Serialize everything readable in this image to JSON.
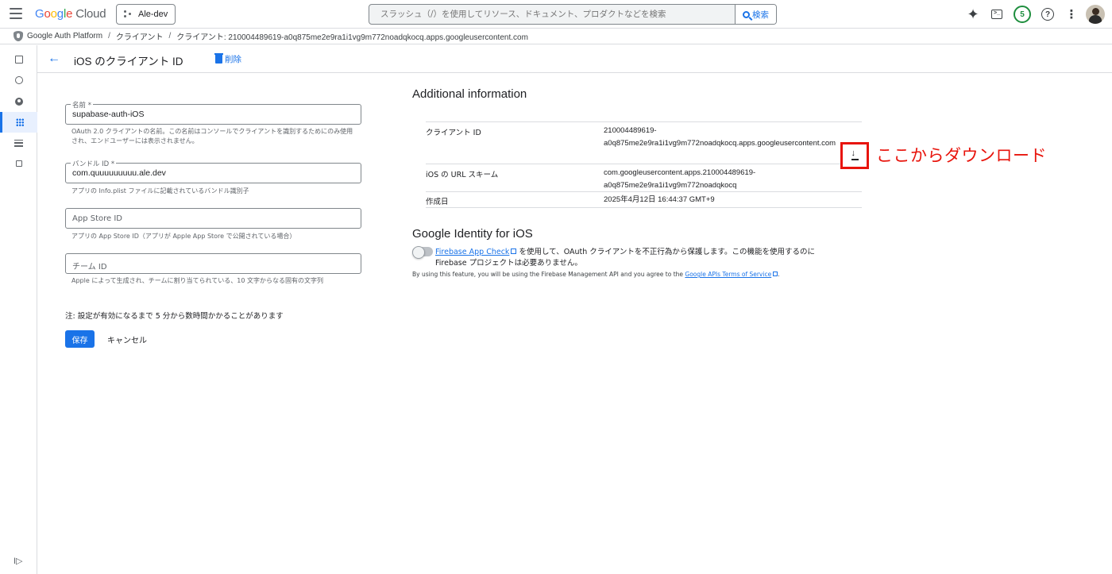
{
  "topbar": {
    "logo_google": [
      "G",
      "o",
      "o",
      "g",
      "l",
      "e"
    ],
    "logo_cloud": "Cloud",
    "project": "Ale-dev",
    "search_placeholder": "スラッシュ（/）を使用してリソース、ドキュメント、プロダクトなどを検索",
    "search_button": "検索",
    "notification_count": "5",
    "icons": [
      "gemini-icon",
      "cloud-shell-icon",
      "notifications-badge",
      "help-icon",
      "more-vert-icon",
      "avatar"
    ]
  },
  "breadcrumb": {
    "items": [
      "Google Auth Platform",
      "クライアント",
      "クライアント: 210004489619-a0q875me2e9ra1i1vg9m772noadqkocq.apps.googleusercontent.com"
    ],
    "separator": "/"
  },
  "rail": {
    "items": [
      "overview-icon",
      "branding-icon",
      "audience-icon",
      "clients-icon",
      "data-access-icon",
      "verification-icon"
    ],
    "active_index": 3,
    "expand": "I▷"
  },
  "page": {
    "title": "iOS のクライアント ID",
    "delete": "削除"
  },
  "form": {
    "name_label": "名前 *",
    "name_value": "supabase-auth-iOS",
    "name_hint": "OAuth 2.0 クライアントの名前。この名前はコンソールでクライアントを識別するためにのみ使用され、エンドユーザーには表示されません。",
    "bundle_label": "バンドル ID *",
    "bundle_value": "com.quuuuuuuuu.ale.dev",
    "bundle_hint": "アプリの Info.plist ファイルに記載されているバンドル識別子",
    "appstore_placeholder": "App Store ID",
    "appstore_hint": "アプリの App Store ID（アプリが Apple App Store で公開されている場合）",
    "team_placeholder": "チーム ID",
    "team_hint": "Apple によって生成され、チームに割り当てられている、10 文字からなる固有の文字列",
    "note": "注: 設定が有効になるまで 5 分から数時間かかることがあります",
    "save": "保存",
    "cancel": "キャンセル"
  },
  "additional": {
    "heading": "Additional information",
    "rows": [
      {
        "key": "クライアント ID",
        "value_line1": "210004489619-",
        "value_line2": "a0q875me2e9ra1i1vg9m772noadqkocq.apps.googleusercontent.com"
      },
      {
        "key": "iOS の URL スキーム",
        "value_line1": "com.googleusercontent.apps.210004489619-",
        "value_line2": "a0q875me2e9ra1i1vg9m772noadqkocq"
      },
      {
        "key": "作成日",
        "value_line1": "2025年4月12日 16:44:37 GMT+9",
        "value_line2": ""
      }
    ],
    "annotation": "ここからダウンロード",
    "annotation_color": "#e8140c"
  },
  "identity": {
    "heading": "Google Identity for iOS",
    "link_app_check": "Firebase App Check",
    "text_after_link": " を使用して、OAuth クライアントを不正行為から保護します。この機能を使用するのに Firebase プロジェクトは必要ありません。",
    "terms_prefix": "By using this feature, you will be using the Firebase Management API and you agree to the ",
    "terms_link": "Google APIs Terms of Service",
    "terms_suffix": "."
  },
  "colors": {
    "accent": "#1a73e8",
    "annotation": "#e8140c",
    "badge": "#1e8e3e"
  }
}
